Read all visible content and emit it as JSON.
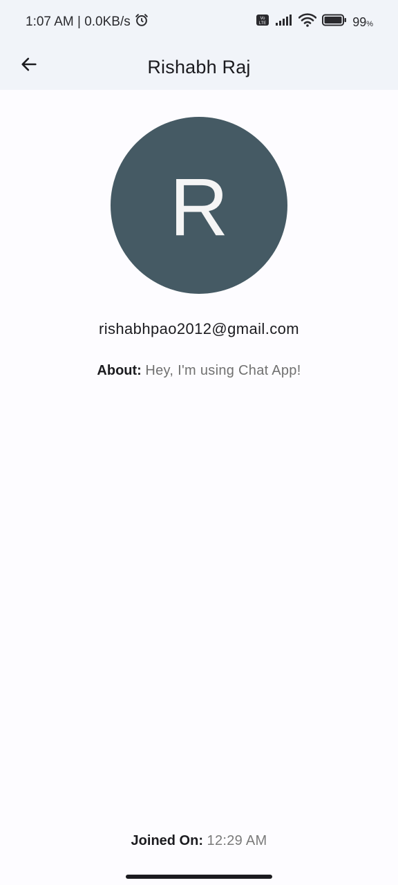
{
  "status_bar": {
    "time_speed": "1:07 AM | 0.0KB/s",
    "battery_percent": "99",
    "battery_unit": "%",
    "icons": [
      "alarm-icon",
      "volte-icon",
      "signal-icon",
      "wifi-icon",
      "battery-icon"
    ]
  },
  "app_bar": {
    "title": "Rishabh Raj",
    "back_icon": "arrow-back-icon"
  },
  "profile": {
    "avatar_letter": "R",
    "avatar_color": "#455a64",
    "email": "rishabhpao2012@gmail.com",
    "about_label": "About:",
    "about_value": "Hey, I'm using Chat App!",
    "joined_label": "Joined On:",
    "joined_value": "12:29 AM"
  }
}
